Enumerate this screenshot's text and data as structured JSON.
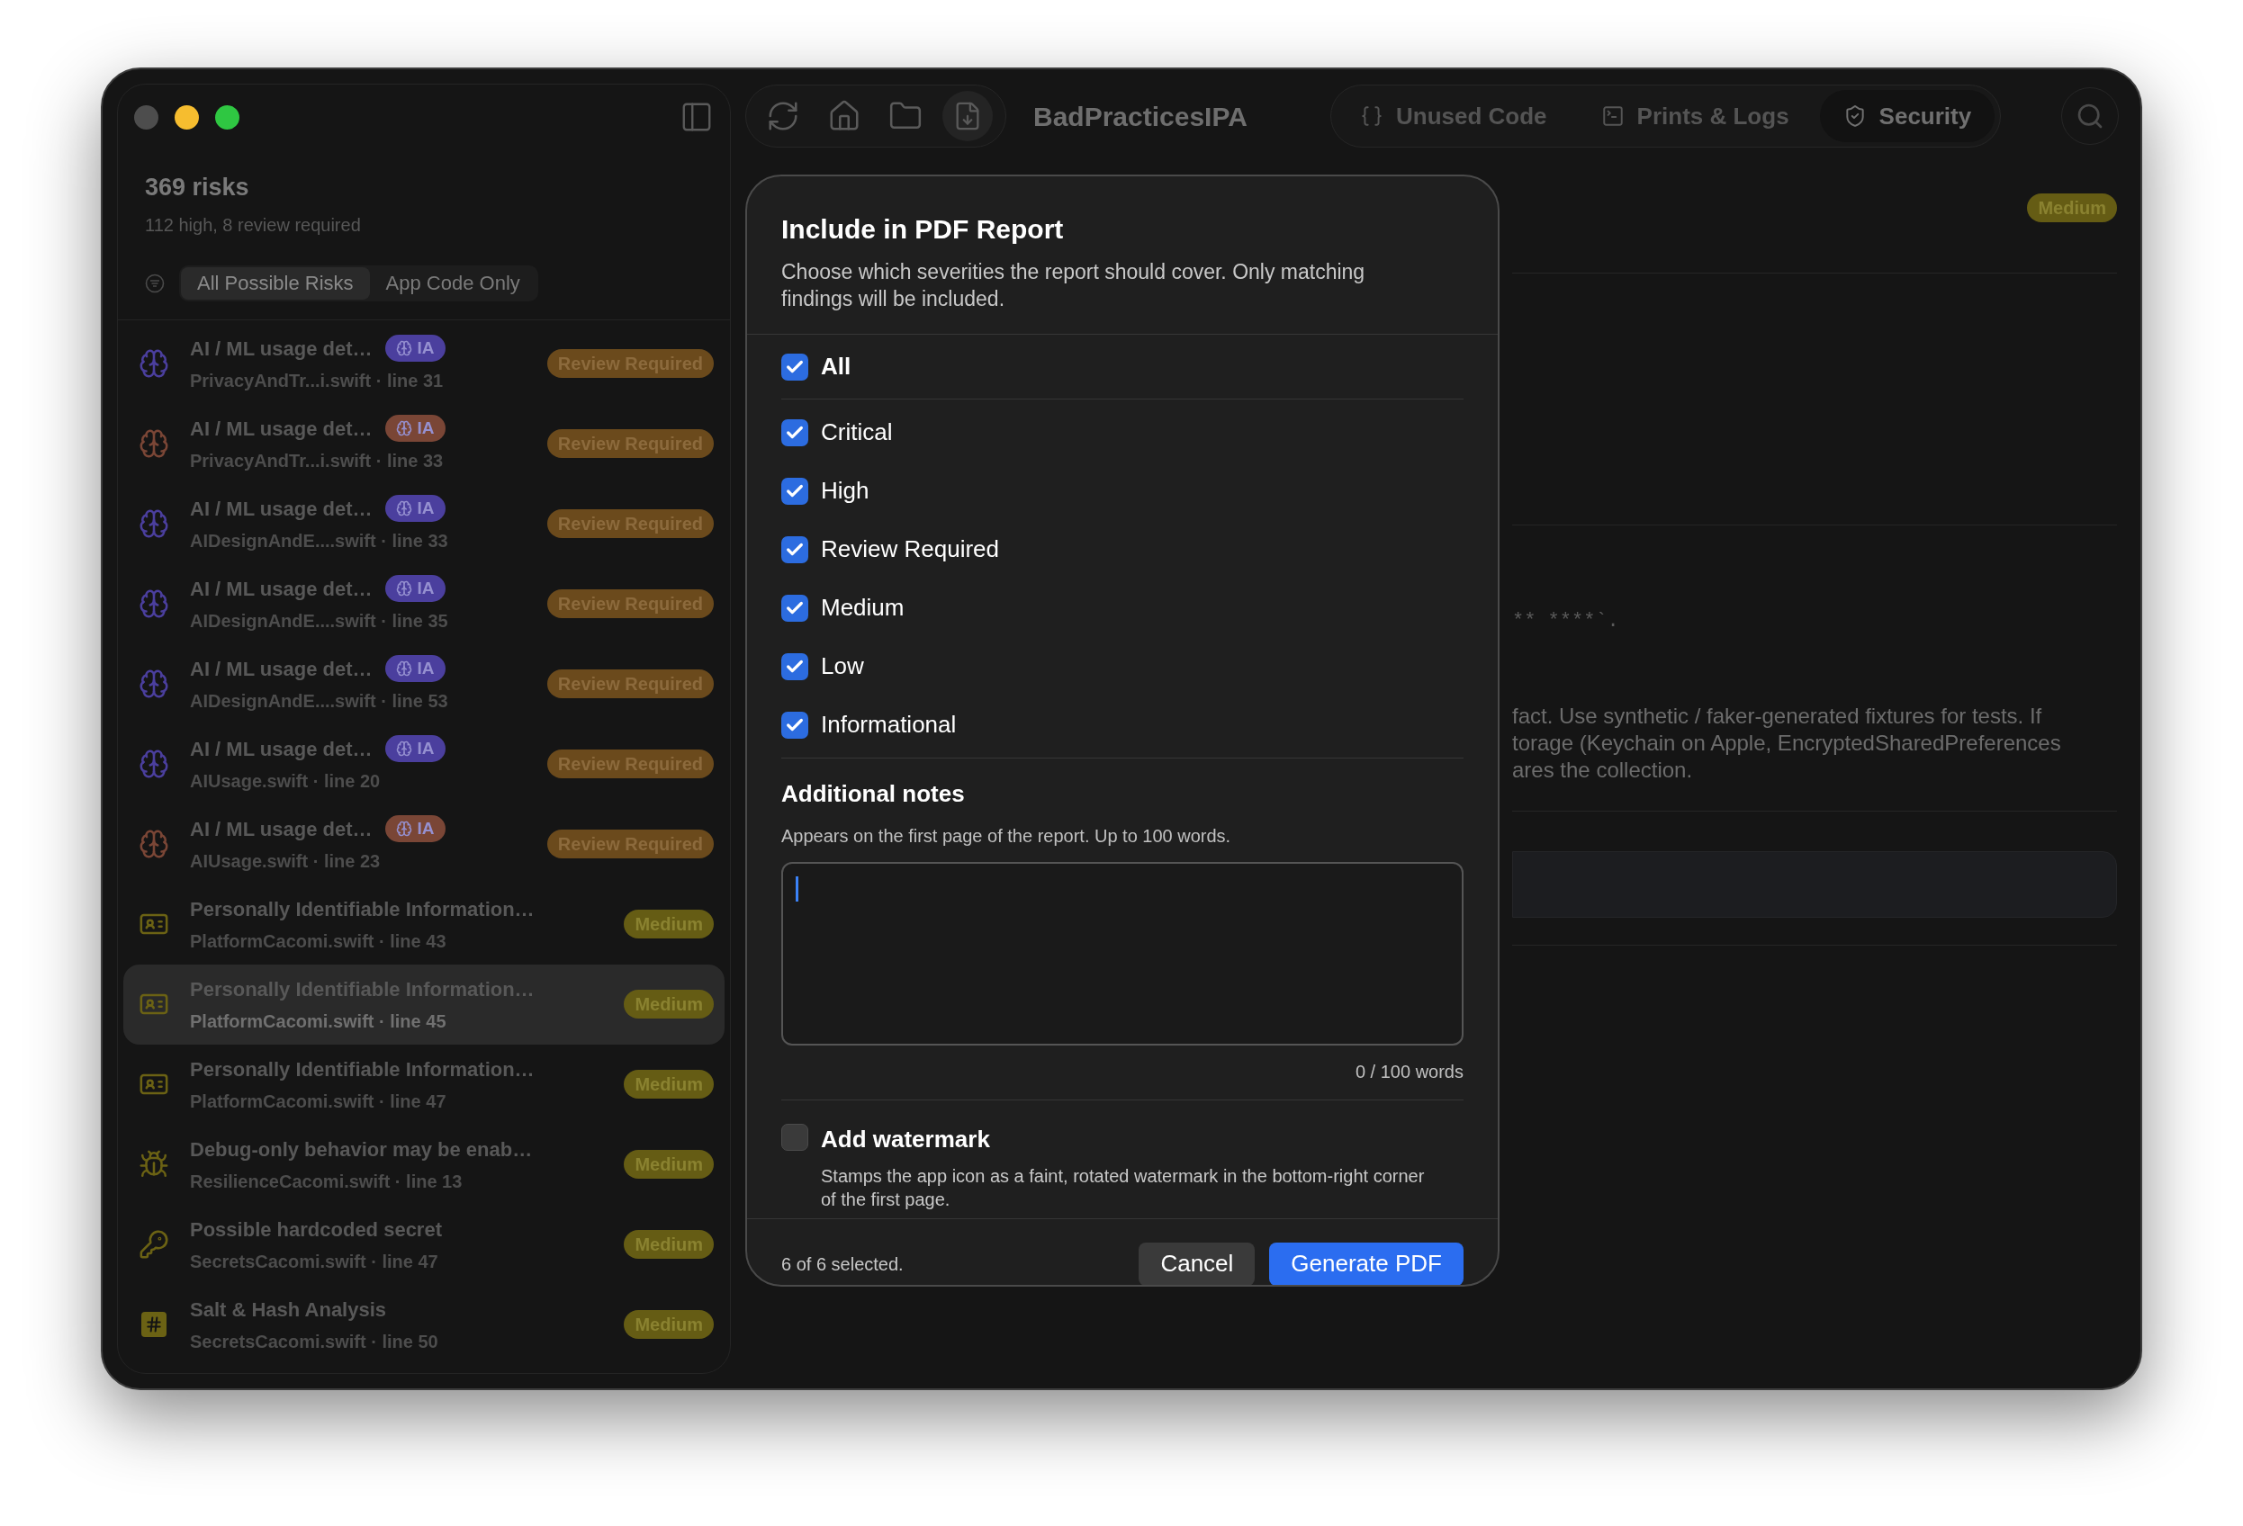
{
  "window": {
    "title": "BadPracticesIPA"
  },
  "toolbar": {
    "tabs": [
      {
        "label": "Unused Code",
        "kind": "code",
        "selected": false
      },
      {
        "label": "Prints & Logs",
        "kind": "terminal",
        "selected": false
      },
      {
        "label": "Security",
        "kind": "shield",
        "selected": true
      }
    ]
  },
  "sidebar": {
    "title": "369 risks",
    "subtitle": "112 high, 8 review required",
    "scope": [
      {
        "label": "All Possible Risks",
        "selected": true
      },
      {
        "label": "App Code Only",
        "selected": false
      }
    ],
    "items": [
      {
        "kind": "ai",
        "title": "AI / ML usage det…",
        "tag": "IA",
        "color": "#4b3f9e",
        "file": "PrivacyAndTr...i.swift · line 31",
        "severity": {
          "label": "Review Required",
          "kind": "review"
        },
        "selected": false
      },
      {
        "kind": "ai",
        "title": "AI / ML usage det…",
        "tag": "IA",
        "color": "#7a4636",
        "file": "PrivacyAndTr...i.swift · line 33",
        "severity": {
          "label": "Review Required",
          "kind": "review"
        },
        "selected": false
      },
      {
        "kind": "ai",
        "title": "AI / ML usage det…",
        "tag": "IA",
        "color": "#4b3f9e",
        "file": "AIDesignAndE....swift · line 33",
        "severity": {
          "label": "Review Required",
          "kind": "review"
        },
        "selected": false
      },
      {
        "kind": "ai",
        "title": "AI / ML usage det…",
        "tag": "IA",
        "color": "#4b3f9e",
        "file": "AIDesignAndE....swift · line 35",
        "severity": {
          "label": "Review Required",
          "kind": "review"
        },
        "selected": false
      },
      {
        "kind": "ai",
        "title": "AI / ML usage det…",
        "tag": "IA",
        "color": "#4b3f9e",
        "file": "AIDesignAndE....swift · line 53",
        "severity": {
          "label": "Review Required",
          "kind": "review"
        },
        "selected": false
      },
      {
        "kind": "ai",
        "title": "AI / ML usage det…",
        "tag": "IA",
        "color": "#4b3f9e",
        "file": "AIUsage.swift · line 20",
        "severity": {
          "label": "Review Required",
          "kind": "review"
        },
        "selected": false
      },
      {
        "kind": "ai",
        "title": "AI / ML usage det…",
        "tag": "IA",
        "color": "#7a4636",
        "file": "AIUsage.swift · line 23",
        "severity": {
          "label": "Review Required",
          "kind": "review"
        },
        "selected": false
      },
      {
        "kind": "pii",
        "title": "Personally Identifiable Information…",
        "color": "#6b6214",
        "file": "PlatformCacomi.swift · line 43",
        "severity": {
          "label": "Medium",
          "kind": "medium"
        },
        "selected": false
      },
      {
        "kind": "pii",
        "title": "Personally Identifiable Information…",
        "color": "#6b6214",
        "file": "PlatformCacomi.swift · line 45",
        "severity": {
          "label": "Medium",
          "kind": "medium"
        },
        "selected": true
      },
      {
        "kind": "pii",
        "title": "Personally Identifiable Information…",
        "color": "#6b6214",
        "file": "PlatformCacomi.swift · line 47",
        "severity": {
          "label": "Medium",
          "kind": "medium"
        },
        "selected": false
      },
      {
        "kind": "bug",
        "title": "Debug-only behavior may be enab…",
        "color": "#6b6214",
        "file": "ResilienceCacomi.swift · line 13",
        "severity": {
          "label": "Medium",
          "kind": "medium"
        },
        "selected": false
      },
      {
        "kind": "key",
        "title": "Possible hardcoded secret",
        "color": "#6b6214",
        "file": "SecretsCacomi.swift · line 47",
        "severity": {
          "label": "Medium",
          "kind": "medium"
        },
        "selected": false
      },
      {
        "kind": "hash",
        "title": "Salt & Hash Analysis",
        "color": "#6b6214",
        "file": "SecretsCacomi.swift · line 50",
        "severity": {
          "label": "Medium",
          "kind": "medium"
        },
        "selected": false
      }
    ]
  },
  "detail": {
    "severity": {
      "label": "Medium",
      "kind": "medium"
    },
    "code_fragment": "** ****`.",
    "paragraph_lines": [
      "fact. Use synthetic / faker-generated fixtures for tests. If",
      "torage (Keychain on Apple, EncryptedSharedPreferences",
      "ares the collection."
    ]
  },
  "dialog": {
    "title": "Include in PDF Report",
    "description": "Choose which severities the report should cover. Only matching findings will be included.",
    "all": {
      "label": "All",
      "checked": true
    },
    "severities": [
      {
        "label": "Critical",
        "checked": true
      },
      {
        "label": "High",
        "checked": true
      },
      {
        "label": "Review Required",
        "checked": true
      },
      {
        "label": "Medium",
        "checked": true
      },
      {
        "label": "Low",
        "checked": true
      },
      {
        "label": "Informational",
        "checked": true
      }
    ],
    "notes": {
      "title": "Additional notes",
      "hint": "Appears on the first page of the report. Up to 100 words.",
      "counter": "0 / 100 words"
    },
    "watermark": {
      "label": "Add watermark",
      "description": "Stamps the app icon as a faint, rotated watermark in the bottom-right corner of the first page.",
      "checked": false
    },
    "status": "6 of 6 selected.",
    "buttons": [
      {
        "label": "Cancel",
        "kind": "secondary"
      },
      {
        "label": "Generate PDF",
        "kind": "primary"
      }
    ]
  }
}
